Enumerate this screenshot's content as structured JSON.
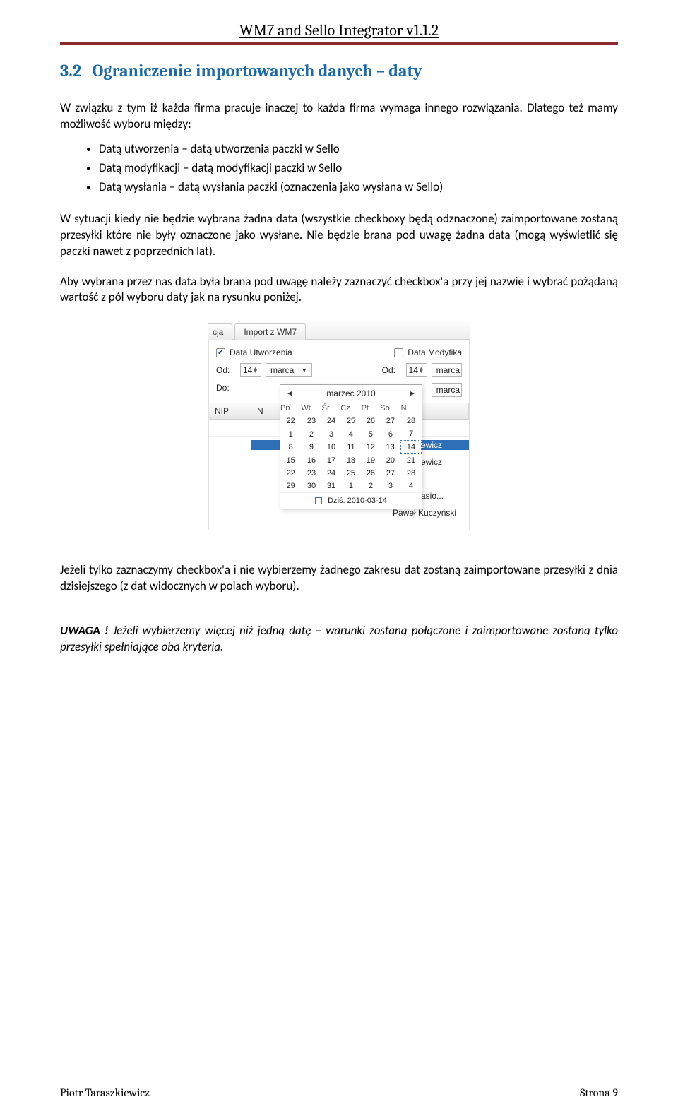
{
  "header": {
    "running_title": "WM7 and Sello Integrator v1.1.2"
  },
  "section": {
    "number": "3.2",
    "title": "Ograniczenie importowanych danych – daty"
  },
  "paragraphs": {
    "p1": "W związku z tym iż każda firma pracuje inaczej to każda firma wymaga innego rozwiązania. Dlatego też mamy możliwość  wyboru między:",
    "p2": "W sytuacji kiedy nie będzie wybrana żadna data (wszystkie checkboxy będą odznaczone) zaimportowane zostaną przesyłki które nie były oznaczone jako wysłane. Nie będzie brana pod uwagę żadna data (mogą wyświetlić się paczki nawet z poprzednich lat).",
    "p3": "Aby wybrana przez nas data była brana pod uwagę należy zaznaczyć checkbox'a przy jej nazwie i wybrać pożądaną wartość z pól wyboru daty jak na rysunku poniżej.",
    "p4": "Jeżeli tylko zaznaczymy checkbox'a i nie wybierzemy żadnego zakresu dat zostaną zaimportowane przesyłki z dnia dzisiejszego (z dat widocznych w polach wyboru).",
    "note_label": "UWAGA !",
    "note_body": " Jeżeli wybierzemy więcej niż jedną datę – warunki zostaną połączone i zaimportowane zostaną tylko przesyłki spełniające oba kryteria."
  },
  "bullets": [
    "Datą utworzenia – datą utworzenia paczki w Sello",
    "Datą modyfikacji – datą modyfikacji paczki w Sello",
    "Datą wysłania – datą wysłania paczki (oznaczenia jako wysłana w Sello)"
  ],
  "screenshot": {
    "tabs": {
      "left_cut": "cja",
      "active": "Import z WM7"
    },
    "checkbox1_label": "Data Utworzenia",
    "checkbox2_label": "Data Modyfika",
    "od_label": "Od:",
    "do_label": "Do:",
    "day_value": "14",
    "month_value": "marca",
    "right_day": "14",
    "right_month": "marca",
    "right_month2": "marca",
    "calendar": {
      "title": "marzec 2010",
      "days": [
        "Pn",
        "Wt",
        "Śr",
        "Cz",
        "Pt",
        "So",
        "N"
      ],
      "rows": [
        [
          "22",
          "23",
          "24",
          "25",
          "26",
          "27",
          "28"
        ],
        [
          "1",
          "2",
          "3",
          "4",
          "5",
          "6",
          "7"
        ],
        [
          "8",
          "9",
          "10",
          "11",
          "12",
          "13",
          "14"
        ],
        [
          "15",
          "16",
          "17",
          "18",
          "19",
          "20",
          "21"
        ],
        [
          "22",
          "23",
          "24",
          "25",
          "26",
          "27",
          "28"
        ],
        [
          "29",
          "30",
          "31",
          "1",
          "2",
          "3",
          "4"
        ]
      ],
      "today_label": "Dziś: 2010-03-14"
    },
    "grid": {
      "header_nip": "NIP",
      "visible_cells": [
        "ewicz",
        "ewicz",
        "asio...",
        "Paweł Kuczyński"
      ]
    }
  },
  "footer": {
    "author": "Piotr Taraszkiewicz",
    "page": "Strona 9"
  }
}
